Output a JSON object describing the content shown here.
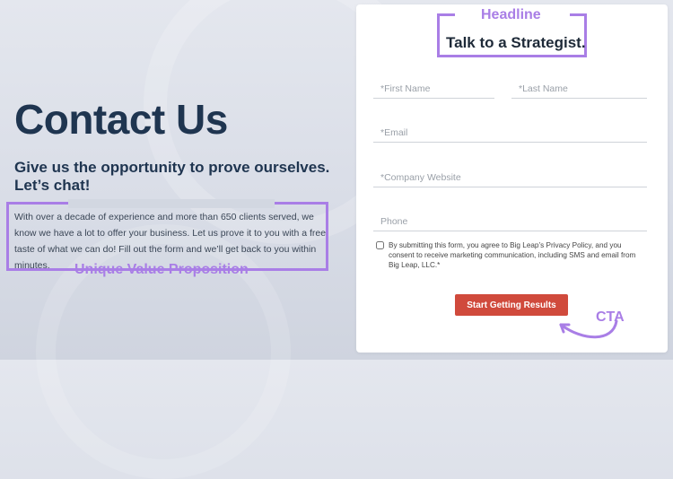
{
  "left": {
    "title": "Contact Us",
    "subtitle": "Give us the opportunity to prove ourselves. Let’s chat!",
    "uvp_text": "With over a decade of experience and more than 650 clients served, we know we have a lot to offer your business. Let us prove it to you with a free taste of what we can do! Fill out the form and we’ll get back to you within minutes.",
    "uvp_annotation": "Unique Value Proposition"
  },
  "form": {
    "headline_annotation": "Headline",
    "headline": "Talk to a Strategist.",
    "fields": {
      "first_name_placeholder": "*First Name",
      "last_name_placeholder": "*Last Name",
      "email_placeholder": "*Email",
      "website_placeholder": "*Company Website",
      "phone_placeholder": "Phone"
    },
    "consent_text": "By submitting this form, you agree to Big Leap’s Privacy Policy, and you consent to receive marketing communication, including SMS and email from Big Leap, LLC.*",
    "cta_label": "Start Getting Results",
    "cta_annotation": "CTA"
  },
  "colors": {
    "annotation": "#a97ee6",
    "heading": "#1f3550",
    "cta": "#d04a3c"
  }
}
